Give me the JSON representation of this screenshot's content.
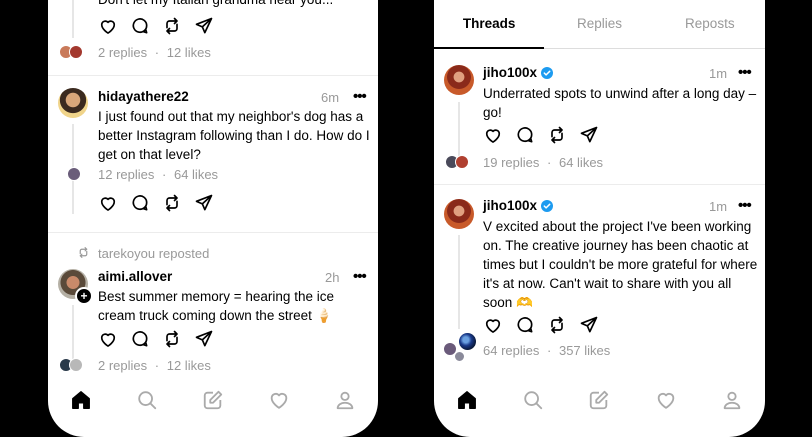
{
  "left_feed": {
    "post1": {
      "text_fragment": "Don't let my Italian grandma hear you...",
      "replies": "2 replies",
      "likes": "12 likes",
      "separator": "·"
    },
    "post2": {
      "username": "hidayathere22",
      "time": "6m",
      "more": "•••",
      "text": "I just found out that my neighbor's dog has a better Instagram following than I do. How do I get on that level?",
      "replies": "12 replies",
      "likes": "64 likes",
      "separator": "·"
    },
    "post3": {
      "repost_label": "tarekoyou reposted",
      "username": "aimi.allover",
      "time": "2h",
      "more": "•••",
      "text": "Best summer memory = hearing the ice cream truck coming down the street 🍦",
      "replies": "2 replies",
      "likes": "12 likes",
      "separator": "·"
    }
  },
  "right_feed": {
    "tabs": [
      {
        "label": "Threads"
      },
      {
        "label": "Replies"
      },
      {
        "label": "Reposts"
      }
    ],
    "post1": {
      "username": "jiho100x",
      "time": "1m",
      "more": "•••",
      "text": "Underrated spots to unwind after a long day – go!",
      "replies": "19 replies",
      "likes": "64 likes",
      "separator": "·"
    },
    "post2": {
      "username": "jiho100x",
      "time": "1m",
      "more": "•••",
      "text": "V excited about the project I've been working on. The creative journey has been chaotic at times but I couldn't be more grateful for where it's at now. Can't wait to share with you all soon 🫶",
      "replies": "64 replies",
      "likes": "357 likes",
      "separator": "·"
    }
  },
  "nav_icons": [
    "home-icon",
    "search-icon",
    "compose-icon",
    "heart-icon",
    "profile-icon"
  ],
  "colors": {
    "verified": "#1d9bf0",
    "muted": "#999999",
    "background": "#000000"
  }
}
